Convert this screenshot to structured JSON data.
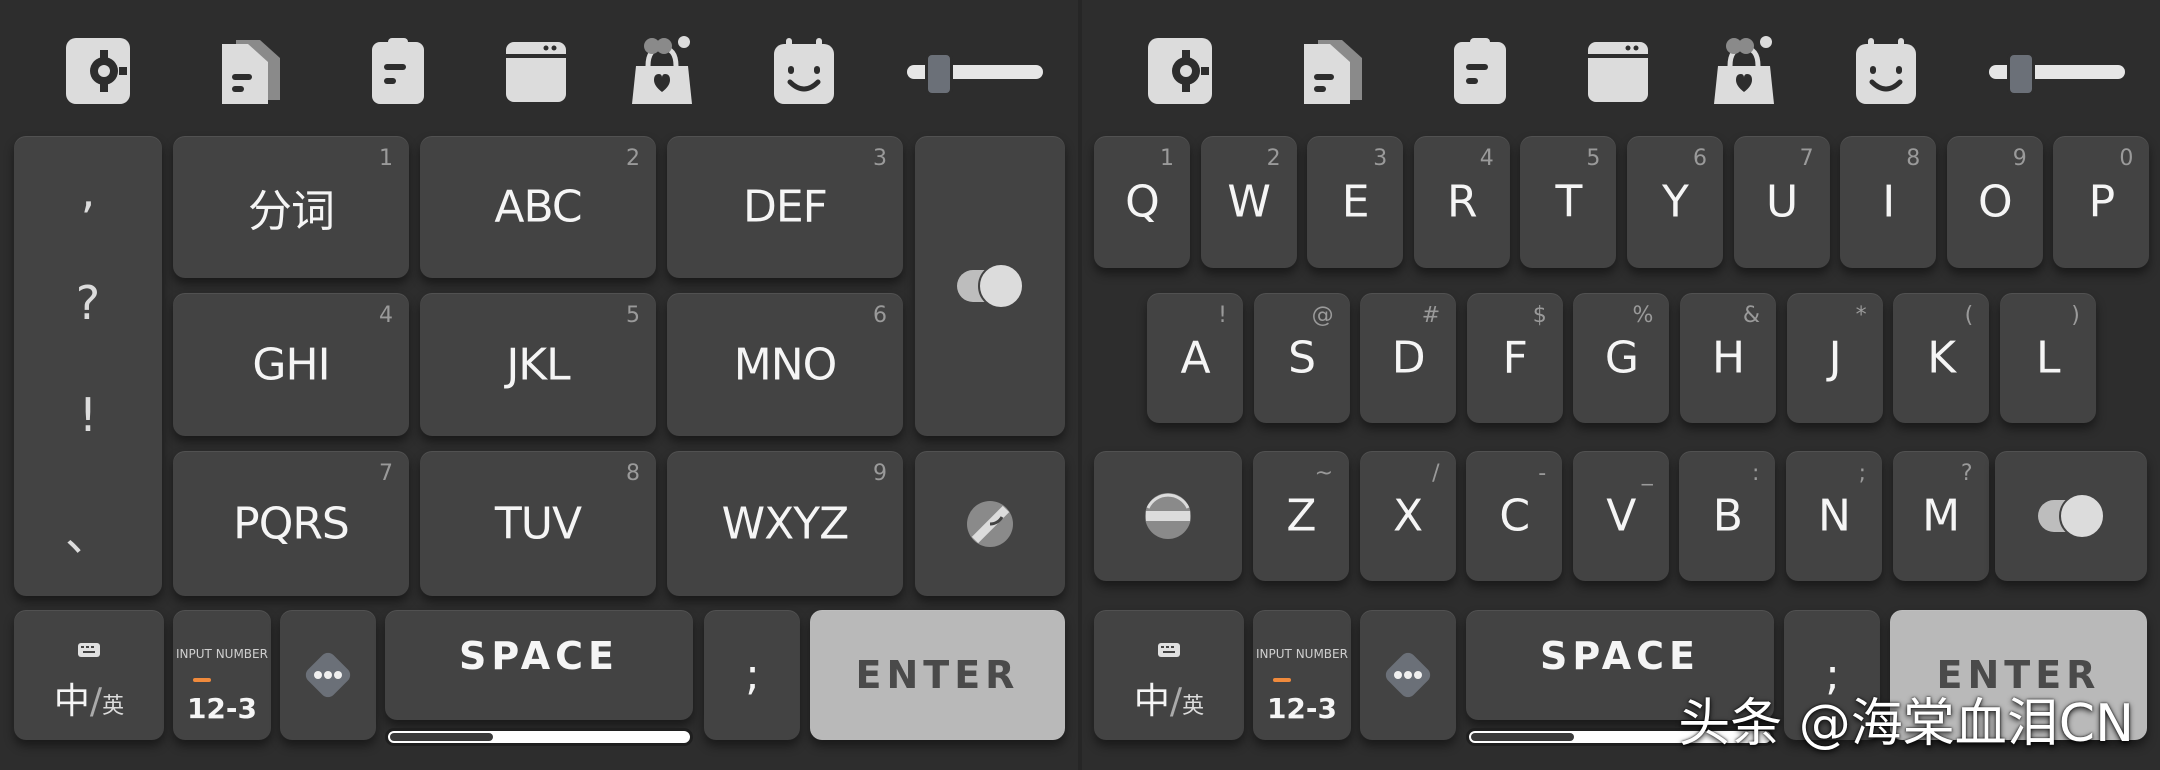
{
  "toolbar": {
    "icons": [
      "settings-icon",
      "document-icon",
      "clipboard-icon",
      "window-icon",
      "favorites-bag-icon",
      "emoji-calendar-icon",
      "slider-icon"
    ]
  },
  "t9": {
    "punctuation": [
      ",",
      "?",
      "!",
      "、"
    ],
    "keys": [
      {
        "label": "分词",
        "num": "1"
      },
      {
        "label": "ABC",
        "num": "2"
      },
      {
        "label": "DEF",
        "num": "3"
      },
      {
        "label": "GHI",
        "num": "4"
      },
      {
        "label": "JKL",
        "num": "5"
      },
      {
        "label": "MNO",
        "num": "6"
      },
      {
        "label": "PQRS",
        "num": "7"
      },
      {
        "label": "TUV",
        "num": "8"
      },
      {
        "label": "WXYZ",
        "num": "9"
      }
    ]
  },
  "qwerty": {
    "row1": [
      {
        "label": "Q",
        "sub": "1"
      },
      {
        "label": "W",
        "sub": "2"
      },
      {
        "label": "E",
        "sub": "3"
      },
      {
        "label": "R",
        "sub": "4"
      },
      {
        "label": "T",
        "sub": "5"
      },
      {
        "label": "Y",
        "sub": "6"
      },
      {
        "label": "U",
        "sub": "7"
      },
      {
        "label": "I",
        "sub": "8"
      },
      {
        "label": "O",
        "sub": "9"
      },
      {
        "label": "P",
        "sub": "0"
      }
    ],
    "row2": [
      {
        "label": "A",
        "sub": "!"
      },
      {
        "label": "S",
        "sub": "@"
      },
      {
        "label": "D",
        "sub": "#"
      },
      {
        "label": "F",
        "sub": "$"
      },
      {
        "label": "G",
        "sub": "%"
      },
      {
        "label": "H",
        "sub": "&"
      },
      {
        "label": "J",
        "sub": "*"
      },
      {
        "label": "K",
        "sub": "("
      },
      {
        "label": "L",
        "sub": ")"
      }
    ],
    "row3": [
      {
        "label": "Z",
        "sub": "~"
      },
      {
        "label": "X",
        "sub": "/"
      },
      {
        "label": "C",
        "sub": "-"
      },
      {
        "label": "V",
        "sub": "_"
      },
      {
        "label": "B",
        "sub": ":"
      },
      {
        "label": "N",
        "sub": ";"
      },
      {
        "label": "M",
        "sub": "?"
      }
    ]
  },
  "bottom": {
    "lang_zh": "中",
    "lang_sep": "/",
    "lang_en": "英",
    "input_number_label": "INPUT NUMBER",
    "input_number_value": "12-3",
    "space": "SPACE",
    "semicolon": ";",
    "enter": "ENTER",
    "space_progress": 0.34
  },
  "watermark": "头条 @海棠血泪CN",
  "colors": {
    "background": "#2d2d2d",
    "key": "#434343",
    "enter_key": "#b9b9b9",
    "accent_orange": "#f08a3c",
    "icon_gray": "#6b7078"
  }
}
